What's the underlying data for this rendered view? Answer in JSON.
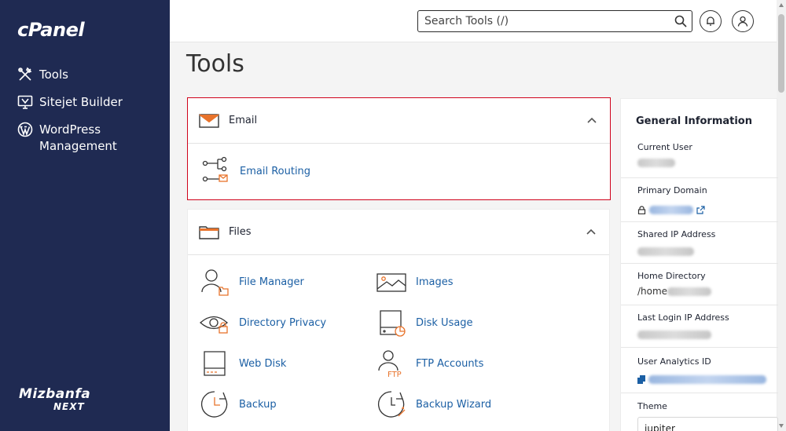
{
  "sidebar": {
    "brand": "cPanel",
    "items": [
      {
        "label": "Tools",
        "icon": "tools-icon"
      },
      {
        "label": "Sitejet Builder",
        "icon": "monitor-icon"
      },
      {
        "label": "WordPress Management",
        "icon": "wordpress-icon"
      }
    ],
    "footer_logo": {
      "line1": "Mizbanfa",
      "line2": "NEXT"
    }
  },
  "topbar": {
    "search_placeholder": "Search Tools (/)",
    "buttons": [
      "bell-icon",
      "user-icon"
    ]
  },
  "page": {
    "title": "Tools"
  },
  "sections": [
    {
      "title": "Email",
      "icon": "envelope-icon",
      "highlight_color": "#d0021b",
      "tools": [
        {
          "label": "Email Routing",
          "icon": "email-routing-icon"
        }
      ]
    },
    {
      "title": "Files",
      "icon": "folder-icon",
      "tools": [
        {
          "label": "File Manager",
          "icon": "file-manager-icon"
        },
        {
          "label": "Images",
          "icon": "images-icon"
        },
        {
          "label": "Directory Privacy",
          "icon": "eye-icon"
        },
        {
          "label": "Disk Usage",
          "icon": "disk-usage-icon"
        },
        {
          "label": "Web Disk",
          "icon": "web-disk-icon"
        },
        {
          "label": "FTP Accounts",
          "icon": "ftp-accounts-icon"
        },
        {
          "label": "Backup",
          "icon": "backup-icon"
        },
        {
          "label": "Backup Wizard",
          "icon": "backup-wizard-icon"
        }
      ]
    }
  ],
  "general_info": {
    "title": "General Information",
    "rows": [
      {
        "label": "Current User"
      },
      {
        "label": "Primary Domain"
      },
      {
        "label": "Shared IP Address"
      },
      {
        "label": "Home Directory",
        "value_prefix": "/home"
      },
      {
        "label": "Last Login IP Address"
      },
      {
        "label": "User Analytics ID"
      },
      {
        "label": "Theme"
      }
    ],
    "theme_value": "jupiter"
  },
  "colors": {
    "sidebar_bg": "#1f2a52",
    "accent_orange": "#e8732b",
    "link_blue": "#1b5fa4",
    "highlight_red": "#d0021b"
  }
}
